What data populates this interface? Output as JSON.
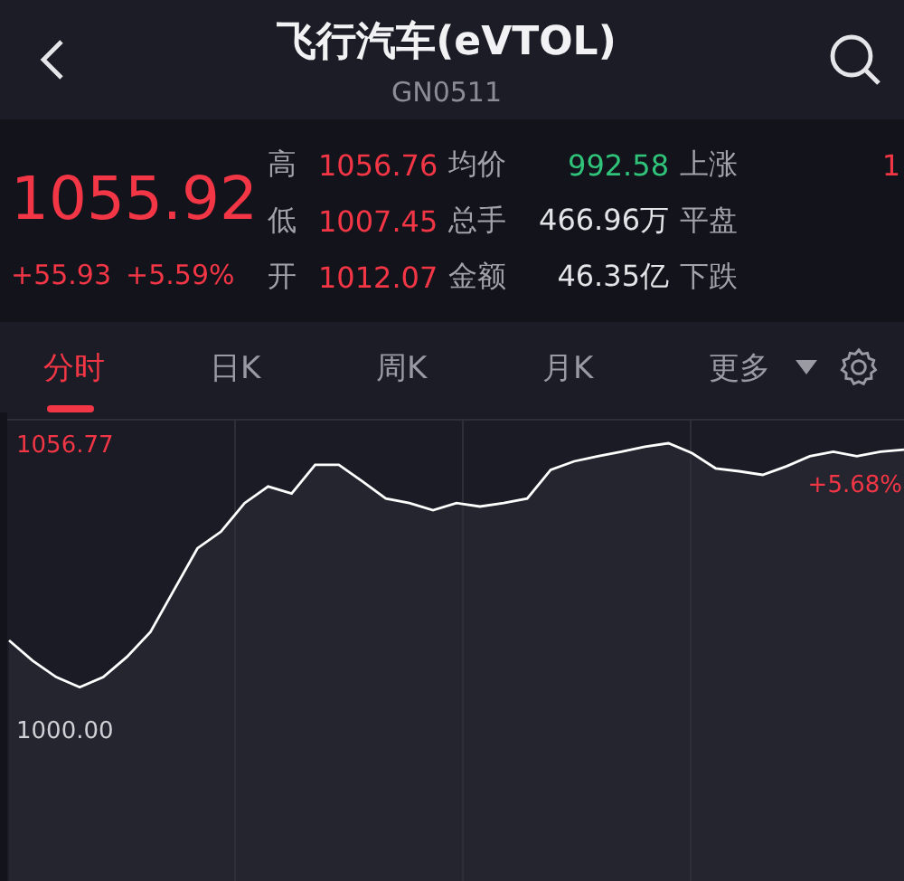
{
  "header": {
    "title": "飞行汽车(eVTOL)",
    "code": "GN0511"
  },
  "quote": {
    "price": "1055.92",
    "change": "+55.93",
    "change_pct": "+5.59%",
    "stats": [
      {
        "label": "高",
        "value": "1056.76",
        "color": "#f23645"
      },
      {
        "label": "均价",
        "value": "992.58",
        "color": "#2fc47a"
      },
      {
        "label": "上涨",
        "value": "1",
        "color": "#f23645"
      },
      {
        "label": "低",
        "value": "1007.45",
        "color": "#f23645"
      },
      {
        "label": "总手",
        "value": "466.96万",
        "color": "#e4e4e8"
      },
      {
        "label": "平盘"
      },
      {
        "label": "开",
        "value": "1012.07",
        "color": "#f23645"
      },
      {
        "label": "金额",
        "value": "46.35亿",
        "color": "#e4e4e8"
      },
      {
        "label": "下跌"
      }
    ]
  },
  "tabs": [
    {
      "label": "分时",
      "selected": true,
      "kind": "tab"
    },
    {
      "label": "日K",
      "selected": false,
      "kind": "tab"
    },
    {
      "label": "周K",
      "selected": false,
      "kind": "tab"
    },
    {
      "label": "月K",
      "selected": false,
      "kind": "tab"
    },
    {
      "label": "更多",
      "selected": false,
      "kind": "dropdown"
    }
  ],
  "chart": {
    "pct_label": "+5.68%",
    "chart_data": {
      "type": "line",
      "ylim": [
        969.8,
        1062.9
      ],
      "yticks": [
        {
          "value": 1056.77,
          "label": "1056.77"
        },
        {
          "value": 1000,
          "label": "1000.00"
        }
      ],
      "series": [
        {
          "color": "#ffffff",
          "values": [
            1017.6,
            1013.6,
            1010.3,
            1008.3,
            1010.3,
            1014.3,
            1019.3,
            1027.6,
            1035.9,
            1039.2,
            1044.9,
            1048.2,
            1046.8,
            1052.5,
            1052.5,
            1049.2,
            1045.8,
            1044.9,
            1043.5,
            1044.9,
            1044.2,
            1044.9,
            1045.8,
            1051.5,
            1053.2,
            1054.2,
            1055.1,
            1056.1,
            1056.8,
            1054.8,
            1051.8,
            1051.2,
            1050.5,
            1052.2,
            1054.2,
            1055.1,
            1054.2,
            1055.1,
            1055.5
          ]
        }
      ]
    }
  }
}
